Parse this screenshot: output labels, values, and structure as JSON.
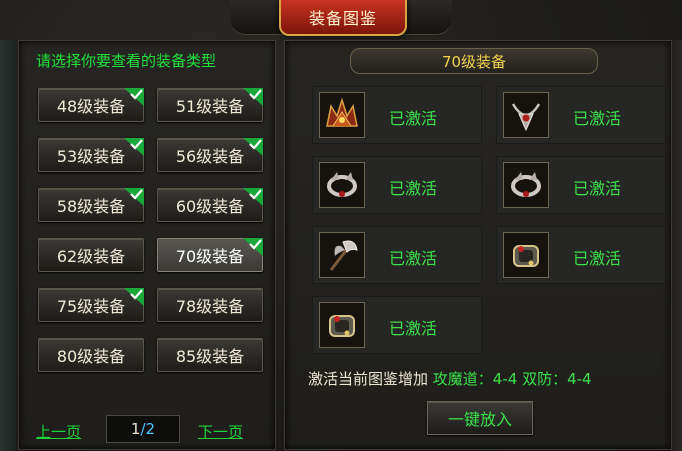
{
  "window": {
    "title": "装备图鉴"
  },
  "left_panel": {
    "heading": "请选择你要查看的装备类型",
    "categories": [
      {
        "label": "48级装备",
        "checked": true,
        "selected": false
      },
      {
        "label": "51级装备",
        "checked": true,
        "selected": false
      },
      {
        "label": "53级装备",
        "checked": true,
        "selected": false
      },
      {
        "label": "56级装备",
        "checked": true,
        "selected": false
      },
      {
        "label": "58级装备",
        "checked": true,
        "selected": false
      },
      {
        "label": "60级装备",
        "checked": true,
        "selected": false
      },
      {
        "label": "62级装备",
        "checked": false,
        "selected": false
      },
      {
        "label": "70级装备",
        "checked": true,
        "selected": true
      },
      {
        "label": "75级装备",
        "checked": true,
        "selected": false
      },
      {
        "label": "78级装备",
        "checked": false,
        "selected": false
      },
      {
        "label": "80级装备",
        "checked": false,
        "selected": false
      },
      {
        "label": "85级装备",
        "checked": false,
        "selected": false
      }
    ],
    "pager": {
      "prev": "上一页",
      "current": "1",
      "separator": "/",
      "total": "2",
      "next": "下一页"
    }
  },
  "right_panel": {
    "heading": "70级装备",
    "items": [
      {
        "icon": "crown-helmet-icon",
        "status": "已激活"
      },
      {
        "icon": "necklace-icon",
        "status": "已激活"
      },
      {
        "icon": "bracelet-icon",
        "status": "已激活"
      },
      {
        "icon": "bracelet-icon",
        "status": "已激活"
      },
      {
        "icon": "battle-axe-icon",
        "status": "已激活"
      },
      {
        "icon": "ring-icon",
        "status": "已激活"
      },
      {
        "icon": "ring-icon",
        "status": "已激活"
      }
    ],
    "bonus": {
      "prefix": "激活当前图鉴增加",
      "stats": "攻魔道：4-4 双防：4-4"
    },
    "one_key_button": "一键放入"
  },
  "colors": {
    "accent_green": "#3be14a",
    "gold": "#f3d24d",
    "page_total": "#4fc6ff"
  }
}
